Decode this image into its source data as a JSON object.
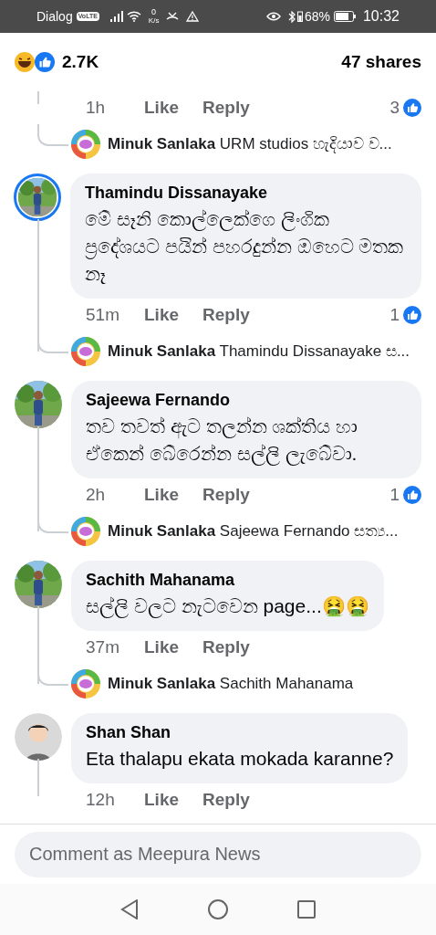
{
  "status_bar": {
    "carrier": "Dialog",
    "volte": "VoLTE",
    "speed_value": "0",
    "speed_unit": "K/s",
    "battery": "68%",
    "time": "10:32"
  },
  "reactions": {
    "count": "2.7K",
    "shares": "47 shares"
  },
  "top_actions": {
    "time": "1h",
    "like": "Like",
    "reply": "Reply",
    "like_count": "3"
  },
  "top_reply": {
    "name": "Minuk Sanlaka",
    "text": "URM studios හැදියාව ව..."
  },
  "comments": [
    {
      "name": "Thamindu Dissanayake",
      "text": "මේ සෑනි කොල්ලෙක්ගෙ ලිංගික ප්‍රදේශයට පයින් පහරදුන්න ඔහෙට මතක නෑ",
      "story": true,
      "time": "51m",
      "like": "Like",
      "reply": "Reply",
      "like_count": "1",
      "reply_preview": {
        "name": "Minuk Sanlaka",
        "text": "Thamindu Dissanayake ස..."
      }
    },
    {
      "name": "Sajeewa Fernando",
      "text": "තව තවත් ඇට තලන්න ශක්තිය හා ඒකෙන් බේරෙන්න සල්ලි ලැබේවා.",
      "story": false,
      "time": "2h",
      "like": "Like",
      "reply": "Reply",
      "like_count": "1",
      "reply_preview": {
        "name": "Minuk Sanlaka",
        "text": "Sajeewa Fernando සත්‍ය..."
      }
    },
    {
      "name": "Sachith Mahanama",
      "text": "සල්ලි වලට නැටවෙන page...🤮🤮",
      "story": false,
      "time": "37m",
      "like": "Like",
      "reply": "Reply",
      "reply_preview": {
        "name": "Minuk Sanlaka",
        "text": "Sachith Mahanama"
      }
    },
    {
      "name": "Shan Shan",
      "text": "Eta thalapu ekata mokada karanne?",
      "story": false,
      "kind": "cartoon",
      "time": "12h",
      "like": "Like",
      "reply": "Reply"
    }
  ],
  "composer": {
    "placeholder": "Comment as Meepura News"
  }
}
